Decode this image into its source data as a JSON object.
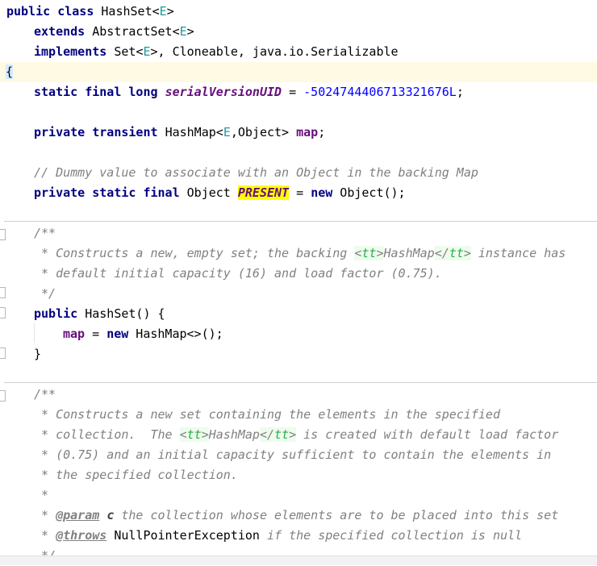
{
  "code": {
    "class_decl": {
      "kw_public": "public",
      "kw_class": "class",
      "name": "HashSet",
      "lt": "<",
      "tparam": "E",
      "gt": ">"
    },
    "extends_line": {
      "kw": "extends",
      "type": "AbstractSet",
      "lt": "<",
      "tparam": "E",
      "gt": ">"
    },
    "implements_line": {
      "kw": "implements",
      "type": "Set",
      "lt": "<",
      "tparam": "E",
      "rest": ">, Cloneable, java.io.Serializable"
    },
    "open_brace": "{",
    "serial_line": {
      "kw": "static final long",
      "field": "serialVersionUID",
      "eq": " = ",
      "value": "-5024744406713321676L",
      "semi": ";"
    },
    "map_line": {
      "kw": "private transient",
      "type": "HashMap<",
      "tparam": "E",
      "rest": ",Object> ",
      "field": "map",
      "semi": ";"
    },
    "dummy_comment": "// Dummy value to associate with an Object in the backing Map",
    "present_line": {
      "kw": "private static final",
      "type": " Object ",
      "field": "PRESENT",
      "eq": " = ",
      "kw_new": "new",
      "rest": " Object();"
    },
    "doc1": {
      "open": "/**",
      "l1_a": " * Constructs a new, empty set; the backing ",
      "tag_open_lt": "<",
      "tag_name": "tt",
      "tag_open_gt": ">",
      "l1_mid": "HashMap",
      "tag_close_lt": "</",
      "tag_close_name": "tt",
      "tag_close_gt": ">",
      "l1_b": " instance has",
      "l2": " * default initial capacity (16) and load factor (0.75).",
      "close": " */"
    },
    "ctor1": {
      "kw": "public",
      "sig": " HashSet() {",
      "body_field": "map",
      "body_eq": " = ",
      "body_new": "new",
      "body_rest": " HashMap<>();",
      "close": "}"
    },
    "doc2": {
      "open": "/**",
      "l1": " * Constructs a new set containing the elements in the specified",
      "l2_a": " * collection.  The ",
      "tag_open_lt": "<",
      "tag_name": "tt",
      "tag_open_gt": ">",
      "l2_mid": "HashMap",
      "tag_close_lt": "</",
      "tag_close_name": "tt",
      "tag_close_gt": ">",
      "l2_b": " is created with default load factor",
      "l3": " * (0.75) and an initial capacity sufficient to contain the elements in",
      "l4": " * the specified collection.",
      "l5": " *",
      "l6_star": " * ",
      "l6_tag": "@param",
      "l6_name": "c",
      "l6_rest": " the collection whose elements are to be placed into this set",
      "l7_star": " * ",
      "l7_tag": "@throws",
      "l7_name": "NullPointerException",
      "l7_rest": " if the specified collection is null",
      "close": " */"
    }
  }
}
